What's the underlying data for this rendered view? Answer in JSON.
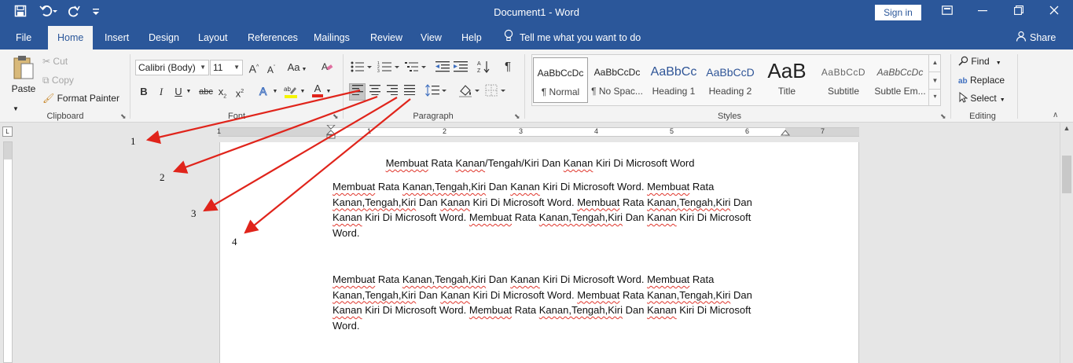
{
  "titlebar": {
    "doc_title": "Document1 - Word",
    "sign_in": "Sign in",
    "icons": [
      "save-icon",
      "undo-icon",
      "redo-icon",
      "customize-icon",
      "ribbon-display-icon",
      "minimize-icon",
      "restore-icon",
      "close-icon"
    ]
  },
  "tabs": [
    {
      "label": "File"
    },
    {
      "label": "Home",
      "active": true
    },
    {
      "label": "Insert"
    },
    {
      "label": "Design"
    },
    {
      "label": "Layout"
    },
    {
      "label": "References"
    },
    {
      "label": "Mailings"
    },
    {
      "label": "Review"
    },
    {
      "label": "View"
    },
    {
      "label": "Help"
    }
  ],
  "tell_me": "Tell me what you want to do",
  "share": "Share",
  "clipboard": {
    "paste": "Paste",
    "cut": "Cut",
    "copy": "Copy",
    "format_painter": "Format Painter",
    "label": "Clipboard"
  },
  "font": {
    "name": "Calibri (Body)",
    "size": "11",
    "grow": "A",
    "shrink": "A",
    "case": "Aa",
    "bold": "B",
    "italic": "I",
    "underline": "U",
    "strike": "abc",
    "subscript": "x",
    "superscript": "x",
    "color_letter": "A",
    "label": "Font"
  },
  "paragraph": {
    "label": "Paragraph"
  },
  "styles": {
    "items": [
      {
        "preview": "AaBbCcDc",
        "name": "¶ Normal"
      },
      {
        "preview": "AaBbCcDc",
        "name": "¶ No Spac..."
      },
      {
        "preview": "AaBbCc",
        "name": "Heading 1"
      },
      {
        "preview": "AaBbCcD",
        "name": "Heading 2"
      },
      {
        "preview": "AaB",
        "name": "Title"
      },
      {
        "preview": "AaBbCcD",
        "name": "Subtitle"
      },
      {
        "preview": "AaBbCcDc",
        "name": "Subtle Em..."
      }
    ],
    "label": "Styles"
  },
  "editing": {
    "find": "Find",
    "replace": "Replace",
    "select": "Select",
    "label": "Editing"
  },
  "ruler": {
    "numbers": [
      "1",
      "1",
      "2",
      "3",
      "4",
      "5",
      "6",
      "7"
    ]
  },
  "document": {
    "heading_parts": [
      "Membuat",
      " Rata ",
      "Kanan",
      "/Tengah/Kiri Dan ",
      "Kanan",
      " Kiri Di Microsoft Word"
    ],
    "para_lines": [
      [
        "Membuat",
        " Rata ",
        "Kanan,Tengah,Kiri",
        " Dan ",
        "Kanan",
        " Kiri Di Microsoft Word. ",
        "Membuat",
        " Rata"
      ],
      [
        "Kanan,Tengah,Kiri",
        " Dan ",
        "Kanan",
        " Kiri Di Microsoft Word. ",
        "Membuat",
        " Rata ",
        "Kanan,Tengah,Kiri",
        " Dan"
      ],
      [
        "Kanan",
        " Kiri Di Microsoft Word. ",
        "Membuat",
        " Rata ",
        "Kanan,Tengah,Kiri",
        " Dan ",
        "Kanan",
        " Kiri Di Microsoft"
      ],
      [
        "Word."
      ]
    ]
  },
  "annotations": [
    "1",
    "2",
    "3",
    "4"
  ],
  "colors": {
    "word_blue": "#2b579a",
    "arrow_red": "#e0241b",
    "squiggle_red": "#e0362c"
  }
}
